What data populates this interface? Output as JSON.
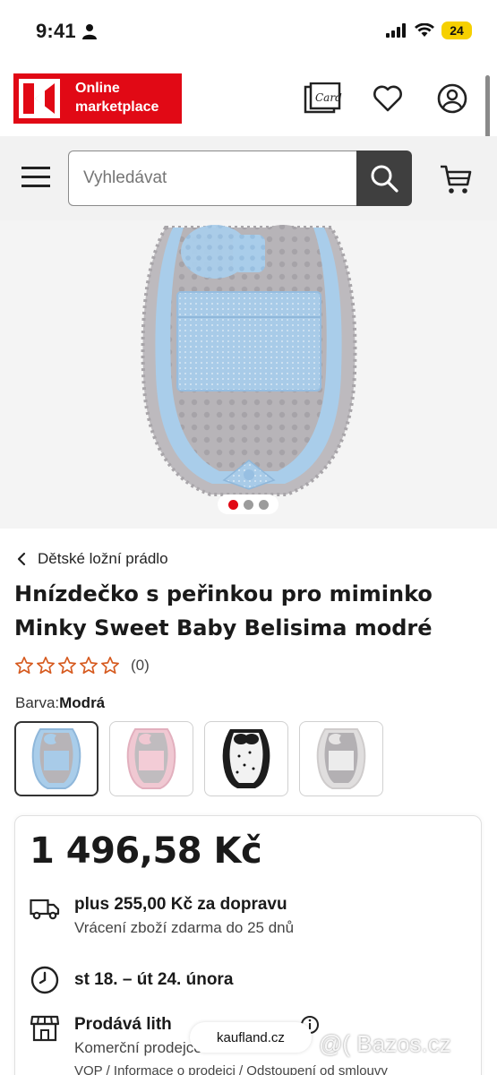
{
  "status_bar": {
    "time": "9:41",
    "battery": "24"
  },
  "header": {
    "logo_text": "Online marketplace",
    "card_icon_label": "Card"
  },
  "search": {
    "placeholder": "Vyhledávat"
  },
  "gallery": {
    "slide_count": 3,
    "active_slide": 1
  },
  "breadcrumb": {
    "label": "Dětské ložní prádlo"
  },
  "product": {
    "title": "Hnízdečko s peřinkou pro miminko Minky Sweet Baby Belisima modré",
    "rating_count": "(0)",
    "rating_stars": 0,
    "color_label": "Barva:",
    "color_value": "Modrá",
    "variants": [
      {
        "name": "Modrá",
        "color": "#a9cdea"
      },
      {
        "name": "Růžová",
        "color": "#f0c8d2"
      },
      {
        "name": "Černobílá",
        "color": "#1c1c1c"
      },
      {
        "name": "Šedá",
        "color": "#cfcfcf"
      }
    ]
  },
  "price_card": {
    "price": "1 496,58 Kč",
    "shipping_main": "plus 255,00 Kč za dopravu",
    "shipping_sub": "Vrácení zboží zdarma do 25 dnů",
    "delivery": "st 18. – út 24. února",
    "seller_main": "Prodává lith",
    "seller_sub": "Komerční prodejce",
    "seller_links": "VOP / Informace o prodejci / Odstoupení od smlouvy"
  },
  "overlay": {
    "kaufland": "kaufland.cz",
    "bazos": "@( Bazos.cz"
  },
  "colors": {
    "brand_red": "#e10915",
    "dark": "#3f3f3f",
    "star_orange": "#d65a1f"
  }
}
